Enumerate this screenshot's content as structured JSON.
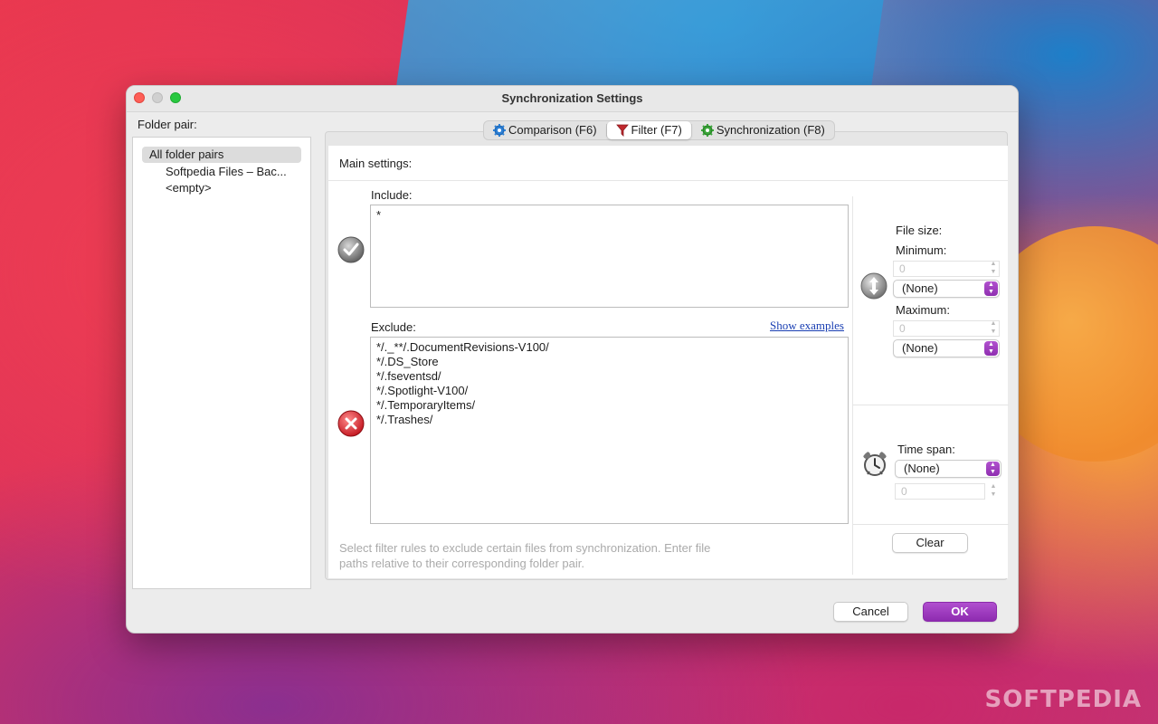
{
  "window": {
    "title": "Synchronization Settings"
  },
  "folder_pairs": {
    "label": "Folder pair:",
    "items": [
      "All folder pairs",
      "Softpedia Files – Bac...",
      "<empty>"
    ]
  },
  "tabs": [
    {
      "label": "Comparison (F6)",
      "icon": "gear-icon"
    },
    {
      "label": "Filter (F7)",
      "icon": "funnel-icon"
    },
    {
      "label": "Synchronization (F8)",
      "icon": "gear-icon"
    }
  ],
  "filter": {
    "main_settings": "Main settings:",
    "include_label": "Include:",
    "include_lines": [
      "*"
    ],
    "exclude_label": "Exclude:",
    "show_examples": "Show examples",
    "exclude_lines": [
      "*/._**/.DocumentRevisions-V100/",
      "*/.DS_Store",
      "*/.fseventsd/",
      "*/.Spotlight-V100/",
      "*/.TemporaryItems/",
      "*/.Trashes/"
    ],
    "hint_line1": "Select filter rules to exclude certain files from synchronization. Enter file",
    "hint_line2": "paths relative to their corresponding folder pair."
  },
  "file_size": {
    "label": "File size:",
    "min_label": "Minimum:",
    "min_value": "0",
    "min_unit": "(None)",
    "max_label": "Maximum:",
    "max_value": "0",
    "max_unit": "(None)"
  },
  "time_span": {
    "label": "Time span:",
    "unit": "(None)",
    "value": "0"
  },
  "buttons": {
    "clear": "Clear",
    "cancel": "Cancel",
    "ok": "OK"
  },
  "colors": {
    "accent": "#9a36bd",
    "link": "#1a3fb3"
  },
  "watermark": "SOFTPEDIA"
}
